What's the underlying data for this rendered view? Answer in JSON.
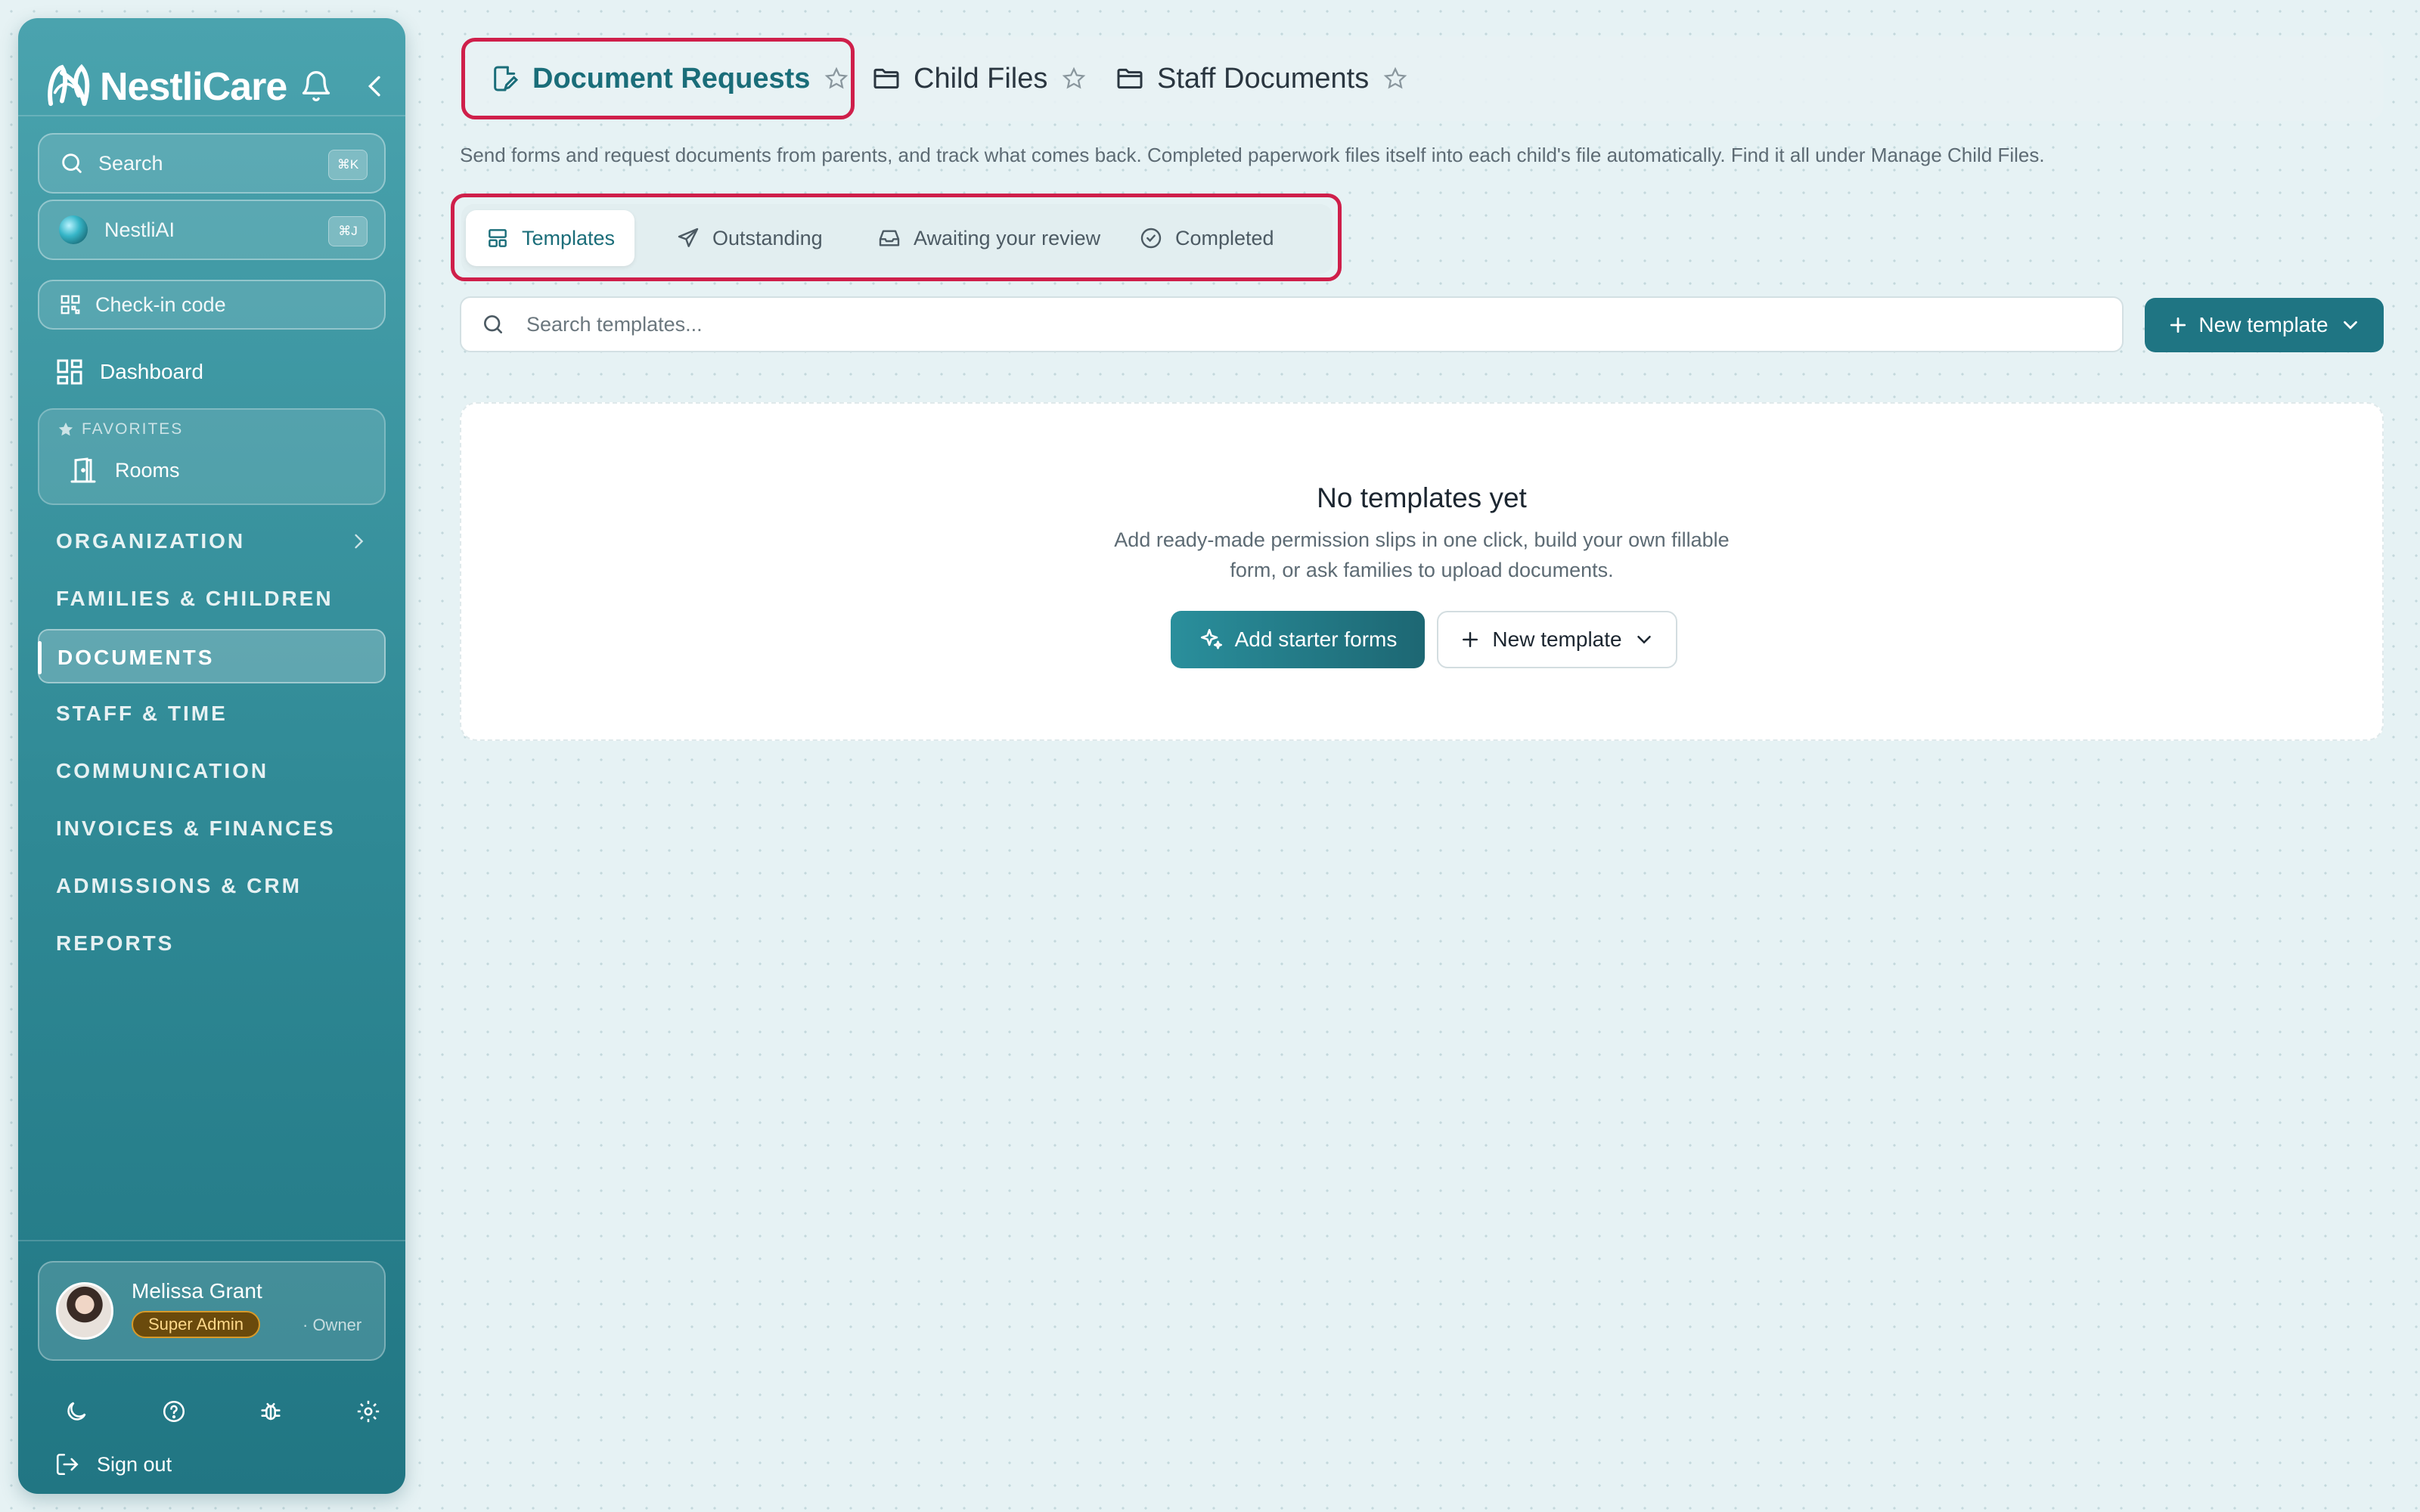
{
  "sidebar": {
    "brand": "NestliCare",
    "search": {
      "label": "Search",
      "shortcut": "⌘K"
    },
    "ai": {
      "label": "NestliAI",
      "shortcut": "⌘J"
    },
    "checkin": {
      "label": "Check-in code"
    },
    "dashboard": "Dashboard",
    "favorites": {
      "title": "FAVORITES",
      "items": [
        "Rooms"
      ]
    },
    "sections": [
      "ORGANIZATION",
      "FAMILIES & CHILDREN",
      "DOCUMENTS",
      "STAFF & TIME",
      "COMMUNICATION",
      "INVOICES & FINANCES",
      "ADMISSIONS & CRM",
      "REPORTS"
    ],
    "active_section": "DOCUMENTS",
    "user": {
      "name": "Melissa Grant",
      "role": "Super Admin",
      "sub": "· Owner"
    },
    "utility_icons": [
      "moon-icon",
      "help-icon",
      "bug-icon",
      "settings-icon"
    ],
    "sign_out": "Sign out"
  },
  "top_tabs": [
    {
      "label": "Document Requests",
      "icon": "file-edit-icon",
      "active": true
    },
    {
      "label": "Child Files",
      "icon": "folder-icon",
      "active": false
    },
    {
      "label": "Staff Documents",
      "icon": "folder-icon",
      "active": false
    }
  ],
  "subtitle": "Send forms and request documents from parents, and track what comes back. Completed paperwork files itself into each child's file automatically. Find it all under Manage Child Files.",
  "sub_tabs": [
    {
      "label": "Templates",
      "icon": "layout-icon",
      "active": true
    },
    {
      "label": "Outstanding",
      "icon": "send-icon",
      "active": false
    },
    {
      "label": "Awaiting your review",
      "icon": "inbox-icon",
      "active": false
    },
    {
      "label": "Completed",
      "icon": "check-circle-icon",
      "active": false
    }
  ],
  "search": {
    "placeholder": "Search templates..."
  },
  "new_template_button": "New template",
  "empty_state": {
    "title": "No templates yet",
    "description": "Add ready-made permission slips in one click, build your own fillable form, or ask families to upload documents.",
    "primary_button": "Add starter forms",
    "secondary_button": "New template"
  },
  "colors": {
    "accent": "#1f7583",
    "highlight": "#cf1f4a",
    "sidebar_top": "#4aa3ae",
    "sidebar_bottom": "#217683",
    "badge": "#6a4a0c"
  }
}
